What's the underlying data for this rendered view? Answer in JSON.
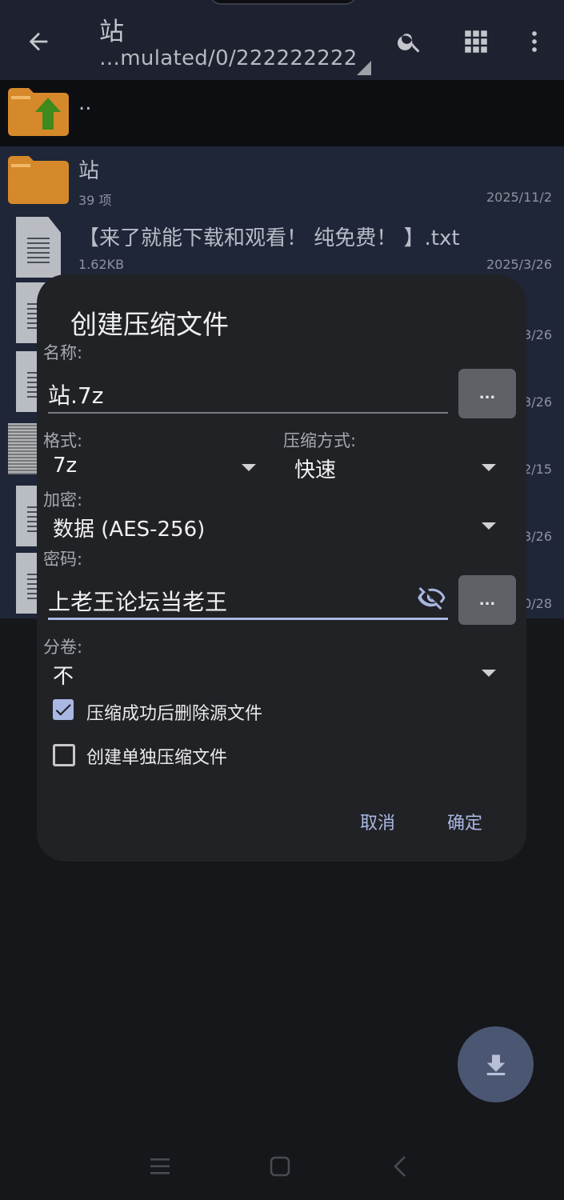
{
  "toolbar": {
    "title": "站",
    "path": "…mulated/0/222222222"
  },
  "list": {
    "parent_label": "..",
    "rows": [
      {
        "name": "站",
        "meta": "39 项",
        "date": "2025/11/2"
      },
      {
        "name": "【来了就能下载和观看！ 纯免费！ 】.txt",
        "meta": "1.62KB",
        "date": "2025/3/26"
      }
    ],
    "peek_dates": [
      "3/26",
      "3/26",
      "2/15",
      "3/26",
      "0/28"
    ]
  },
  "dialog": {
    "title": "创建压缩文件",
    "name_label": "名称:",
    "name_value": "站.7z",
    "browse_label": "...",
    "format_label": "格式:",
    "format_value": "7z",
    "method_label": "压缩方式:",
    "method_value": "快速",
    "encryption_label": "加密:",
    "encryption_value": "数据 (AES-256)",
    "password_label": "密码:",
    "password_value": "上老王论坛当老王",
    "volume_label": "分卷:",
    "volume_value": "不",
    "delete_source_label": "压缩成功后删除源文件",
    "delete_source_checked": true,
    "separate_label": "创建单独压缩文件",
    "separate_checked": false,
    "cancel_label": "取消",
    "ok_label": "确定"
  },
  "colors": {
    "accent": "#a9b7e3",
    "dialog_bg": "#212226",
    "list_selected_bg": "#1f2638",
    "folder": "#d6892a"
  }
}
